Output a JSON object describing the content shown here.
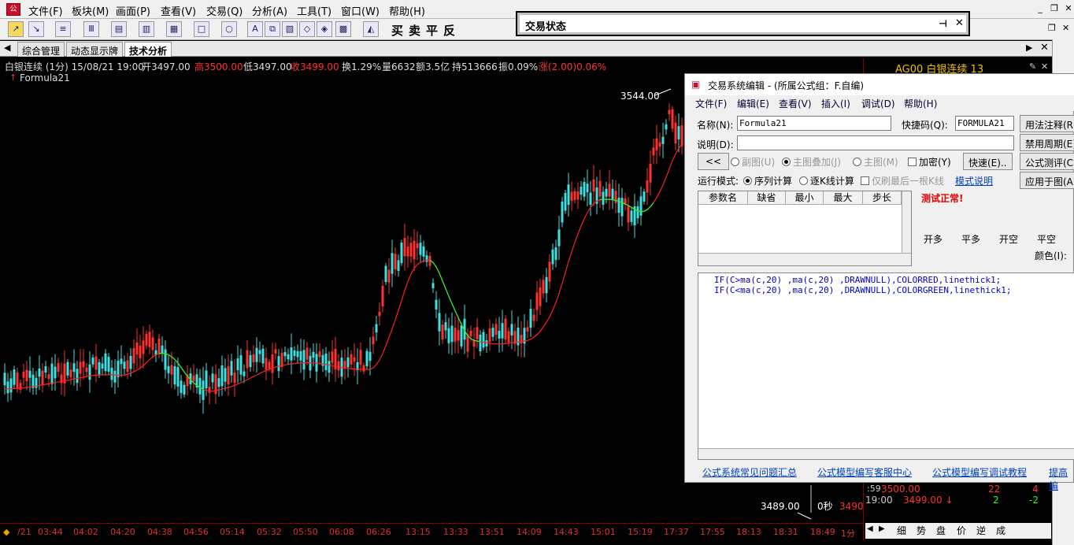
{
  "menubar": {
    "items": [
      "文件(F)",
      "板块(M)",
      "画面(P)",
      "查看(V)",
      "交易(Q)",
      "分析(A)",
      "工具(T)",
      "窗口(W)",
      "帮助(H)"
    ],
    "window_min": "_",
    "window_restore": "❐",
    "window_close": "✕",
    "doc_restore": "❐",
    "doc_close": "✕"
  },
  "toolbar": {
    "trade_buttons": [
      "买",
      "卖",
      "平",
      "反"
    ]
  },
  "status_window": {
    "title": "交易状态",
    "pin": "⊣",
    "close": "✕"
  },
  "tabs": [
    "综合管理",
    "动态显示牌",
    "技术分析"
  ],
  "infobar": {
    "name": "白银连续 (1分) 15/08/21 19:00",
    "open": "开3497.00",
    "high": "高3500.00",
    "low": "低3497.00",
    "close": "收3499.00",
    "turnover": "换1.29%",
    "volume": "量6632",
    "amount": "额3.5亿",
    "oi": "持513666",
    "amp": "振0.09%",
    "change": "涨(2.00)0.06%",
    "indicator": "Formula21"
  },
  "chart": {
    "high_label": "3544.00",
    "low_label": "3489.00",
    "countdown": "0秒",
    "right_price": "3490",
    "trend_up_color": "#ff2020",
    "trend_down_color": "#20ff20",
    "candle_up_color": "#ff3030",
    "candle_down_color": "#40e0e0",
    "last_date": "/21"
  },
  "time_axis": [
    "03:44",
    "04:02",
    "04:20",
    "04:38",
    "04:56",
    "05:14",
    "05:32",
    "05:50",
    "06:08",
    "06:26",
    "13:15",
    "13:33",
    "13:51",
    "14:09",
    "14:43",
    "15:01",
    "15:19",
    "17:37",
    "17:55",
    "18:13",
    "18:31",
    "18:49"
  ],
  "period": "1分",
  "right_panel": {
    "title": "AG00 白银连续 13",
    "rows": [
      {
        "time": ":59",
        "price": "3500.00",
        "vol": "22",
        "oi": "4"
      },
      {
        "time": "19:00",
        "price": "3499.00 ↓",
        "vol": "2",
        "oi": "-2"
      }
    ],
    "bottom_tabs": [
      "细",
      "势",
      "盘",
      "价",
      "逆",
      "成"
    ]
  },
  "dialog": {
    "title": "交易系统编辑 - (所属公式组：F.自编)",
    "menu": [
      "文件(F)",
      "编辑(E)",
      "查看(V)",
      "插入(I)",
      "调试(D)",
      "帮助(H)"
    ],
    "name_label": "名称(N):",
    "name_value": "Formula21",
    "shortcut_label": "快捷码(Q):",
    "shortcut_value": "FORMULA21",
    "desc_label": "说明(D):",
    "desc_value": "",
    "btn_usage": "用法注释(R)",
    "btn_disable_period": "禁用周期(E)",
    "btn_formula_test": "公式测评(C)",
    "btn_apply": "应用于图(A)",
    "btn_back": "<<",
    "opt_subchart": "副图(U)",
    "opt_main_overlay": "主图叠加(J)",
    "opt_main": "主图(M)",
    "opt_encrypt": "加密(Y)",
    "btn_quick": "快速(E)..",
    "run_mode_label": "运行模式:",
    "run_seq": "序列计算",
    "run_tick": "逐K线计算",
    "only_last": "仅刷最后一根K线",
    "mode_help": "模式说明",
    "param_headers": [
      "参数名",
      "缺省",
      "最小",
      "最大",
      "步长"
    ],
    "test_result": "测试正常!",
    "signal_tabs": [
      "开多",
      "平多",
      "开空",
      "平空"
    ],
    "color_label": "颜色(I):",
    "code_lines": [
      "IF(C>ma(c,20)  ,ma(c,20) ,DRAWNULL),COLORRED,linethick1;",
      "IF(C<ma(c,20)  ,ma(c,20) ,DRAWNULL),COLORGREEN,linethick1;"
    ],
    "links": [
      "公式系统常见问题汇总",
      "公式模型编写客服中心",
      "公式模型编写调试教程",
      "提高编"
    ]
  }
}
